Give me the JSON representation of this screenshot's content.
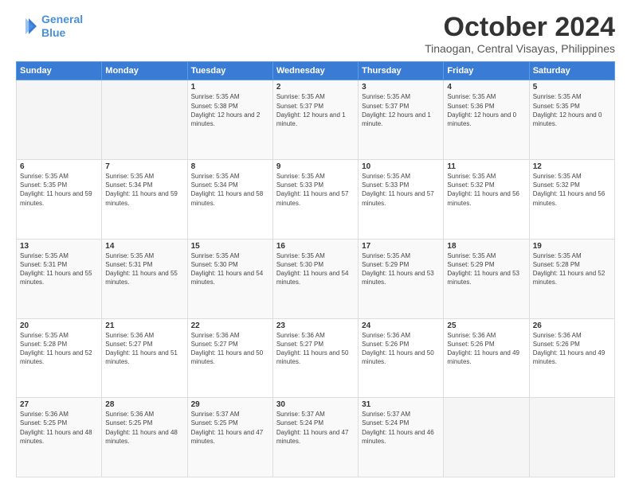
{
  "logo": {
    "line1": "General",
    "line2": "Blue"
  },
  "header": {
    "month": "October 2024",
    "location": "Tinaogan, Central Visayas, Philippines"
  },
  "weekdays": [
    "Sunday",
    "Monday",
    "Tuesday",
    "Wednesday",
    "Thursday",
    "Friday",
    "Saturday"
  ],
  "weeks": [
    [
      {
        "day": "",
        "sunrise": "",
        "sunset": "",
        "daylight": ""
      },
      {
        "day": "",
        "sunrise": "",
        "sunset": "",
        "daylight": ""
      },
      {
        "day": "1",
        "sunrise": "Sunrise: 5:35 AM",
        "sunset": "Sunset: 5:38 PM",
        "daylight": "Daylight: 12 hours and 2 minutes."
      },
      {
        "day": "2",
        "sunrise": "Sunrise: 5:35 AM",
        "sunset": "Sunset: 5:37 PM",
        "daylight": "Daylight: 12 hours and 1 minute."
      },
      {
        "day": "3",
        "sunrise": "Sunrise: 5:35 AM",
        "sunset": "Sunset: 5:37 PM",
        "daylight": "Daylight: 12 hours and 1 minute."
      },
      {
        "day": "4",
        "sunrise": "Sunrise: 5:35 AM",
        "sunset": "Sunset: 5:36 PM",
        "daylight": "Daylight: 12 hours and 0 minutes."
      },
      {
        "day": "5",
        "sunrise": "Sunrise: 5:35 AM",
        "sunset": "Sunset: 5:35 PM",
        "daylight": "Daylight: 12 hours and 0 minutes."
      }
    ],
    [
      {
        "day": "6",
        "sunrise": "Sunrise: 5:35 AM",
        "sunset": "Sunset: 5:35 PM",
        "daylight": "Daylight: 11 hours and 59 minutes."
      },
      {
        "day": "7",
        "sunrise": "Sunrise: 5:35 AM",
        "sunset": "Sunset: 5:34 PM",
        "daylight": "Daylight: 11 hours and 59 minutes."
      },
      {
        "day": "8",
        "sunrise": "Sunrise: 5:35 AM",
        "sunset": "Sunset: 5:34 PM",
        "daylight": "Daylight: 11 hours and 58 minutes."
      },
      {
        "day": "9",
        "sunrise": "Sunrise: 5:35 AM",
        "sunset": "Sunset: 5:33 PM",
        "daylight": "Daylight: 11 hours and 57 minutes."
      },
      {
        "day": "10",
        "sunrise": "Sunrise: 5:35 AM",
        "sunset": "Sunset: 5:33 PM",
        "daylight": "Daylight: 11 hours and 57 minutes."
      },
      {
        "day": "11",
        "sunrise": "Sunrise: 5:35 AM",
        "sunset": "Sunset: 5:32 PM",
        "daylight": "Daylight: 11 hours and 56 minutes."
      },
      {
        "day": "12",
        "sunrise": "Sunrise: 5:35 AM",
        "sunset": "Sunset: 5:32 PM",
        "daylight": "Daylight: 11 hours and 56 minutes."
      }
    ],
    [
      {
        "day": "13",
        "sunrise": "Sunrise: 5:35 AM",
        "sunset": "Sunset: 5:31 PM",
        "daylight": "Daylight: 11 hours and 55 minutes."
      },
      {
        "day": "14",
        "sunrise": "Sunrise: 5:35 AM",
        "sunset": "Sunset: 5:31 PM",
        "daylight": "Daylight: 11 hours and 55 minutes."
      },
      {
        "day": "15",
        "sunrise": "Sunrise: 5:35 AM",
        "sunset": "Sunset: 5:30 PM",
        "daylight": "Daylight: 11 hours and 54 minutes."
      },
      {
        "day": "16",
        "sunrise": "Sunrise: 5:35 AM",
        "sunset": "Sunset: 5:30 PM",
        "daylight": "Daylight: 11 hours and 54 minutes."
      },
      {
        "day": "17",
        "sunrise": "Sunrise: 5:35 AM",
        "sunset": "Sunset: 5:29 PM",
        "daylight": "Daylight: 11 hours and 53 minutes."
      },
      {
        "day": "18",
        "sunrise": "Sunrise: 5:35 AM",
        "sunset": "Sunset: 5:29 PM",
        "daylight": "Daylight: 11 hours and 53 minutes."
      },
      {
        "day": "19",
        "sunrise": "Sunrise: 5:35 AM",
        "sunset": "Sunset: 5:28 PM",
        "daylight": "Daylight: 11 hours and 52 minutes."
      }
    ],
    [
      {
        "day": "20",
        "sunrise": "Sunrise: 5:35 AM",
        "sunset": "Sunset: 5:28 PM",
        "daylight": "Daylight: 11 hours and 52 minutes."
      },
      {
        "day": "21",
        "sunrise": "Sunrise: 5:36 AM",
        "sunset": "Sunset: 5:27 PM",
        "daylight": "Daylight: 11 hours and 51 minutes."
      },
      {
        "day": "22",
        "sunrise": "Sunrise: 5:36 AM",
        "sunset": "Sunset: 5:27 PM",
        "daylight": "Daylight: 11 hours and 50 minutes."
      },
      {
        "day": "23",
        "sunrise": "Sunrise: 5:36 AM",
        "sunset": "Sunset: 5:27 PM",
        "daylight": "Daylight: 11 hours and 50 minutes."
      },
      {
        "day": "24",
        "sunrise": "Sunrise: 5:36 AM",
        "sunset": "Sunset: 5:26 PM",
        "daylight": "Daylight: 11 hours and 50 minutes."
      },
      {
        "day": "25",
        "sunrise": "Sunrise: 5:36 AM",
        "sunset": "Sunset: 5:26 PM",
        "daylight": "Daylight: 11 hours and 49 minutes."
      },
      {
        "day": "26",
        "sunrise": "Sunrise: 5:36 AM",
        "sunset": "Sunset: 5:26 PM",
        "daylight": "Daylight: 11 hours and 49 minutes."
      }
    ],
    [
      {
        "day": "27",
        "sunrise": "Sunrise: 5:36 AM",
        "sunset": "Sunset: 5:25 PM",
        "daylight": "Daylight: 11 hours and 48 minutes."
      },
      {
        "day": "28",
        "sunrise": "Sunrise: 5:36 AM",
        "sunset": "Sunset: 5:25 PM",
        "daylight": "Daylight: 11 hours and 48 minutes."
      },
      {
        "day": "29",
        "sunrise": "Sunrise: 5:37 AM",
        "sunset": "Sunset: 5:25 PM",
        "daylight": "Daylight: 11 hours and 47 minutes."
      },
      {
        "day": "30",
        "sunrise": "Sunrise: 5:37 AM",
        "sunset": "Sunset: 5:24 PM",
        "daylight": "Daylight: 11 hours and 47 minutes."
      },
      {
        "day": "31",
        "sunrise": "Sunrise: 5:37 AM",
        "sunset": "Sunset: 5:24 PM",
        "daylight": "Daylight: 11 hours and 46 minutes."
      },
      {
        "day": "",
        "sunrise": "",
        "sunset": "",
        "daylight": ""
      },
      {
        "day": "",
        "sunrise": "",
        "sunset": "",
        "daylight": ""
      }
    ]
  ]
}
